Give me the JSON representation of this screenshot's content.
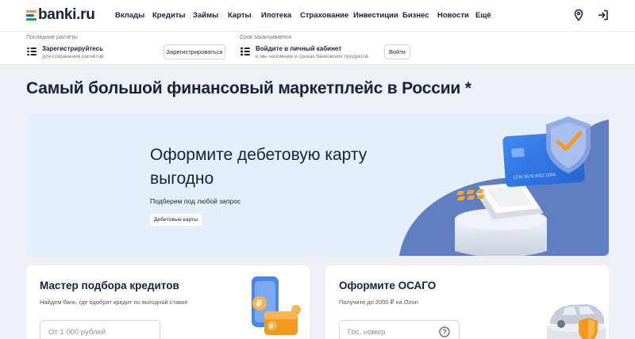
{
  "header": {
    "logo": "banki.ru",
    "nav": [
      "Вклады",
      "Кредиты",
      "Займы",
      "Карты",
      "Ипотека",
      "Страхование",
      "Инвестиции",
      "Бизнес",
      "Новости",
      "Ещё"
    ],
    "icons": [
      "map-pin-icon",
      "login-icon"
    ]
  },
  "infobar": {
    "left": {
      "caption": "Последние расчёты",
      "title": "Зарегистрируйтесь",
      "subtitle": "для сохранения расчётов",
      "button": "Зарегистрироваться"
    },
    "right": {
      "caption": "Срок заканчивается",
      "title": "Войдите в личный кабинет",
      "subtitle": "и мы напомним о сроках банковских продуктов",
      "button": "Войти"
    }
  },
  "hero": {
    "heading": "Самый большой финансовый маркетплейс в России *",
    "banner": {
      "title": "Оформите дебетовую карту выгодно",
      "subtitle": "Подберем под любой запрос",
      "tag": "Дебетовые карты",
      "card_number": "1234 5678 9012 0000"
    }
  },
  "cards": [
    {
      "title": "Мастер подбора кредитов",
      "subtitle": "Найдем банк, где одобрят кредит по выгодной ставке",
      "placeholder": "От 1 000 рублей"
    },
    {
      "title": "Оформите ОСАГО",
      "subtitle": "Получите до 2000 ₽ на Ozon",
      "placeholder": "Гос. номер"
    }
  ],
  "colors": {
    "brand_green": "#23a34a",
    "brand_orange": "#f39a1e",
    "brand_blue": "#2b62c9",
    "banner_bg": "#e6eefa",
    "page_bg": "#eef0f5",
    "text_dark": "#16233a"
  }
}
